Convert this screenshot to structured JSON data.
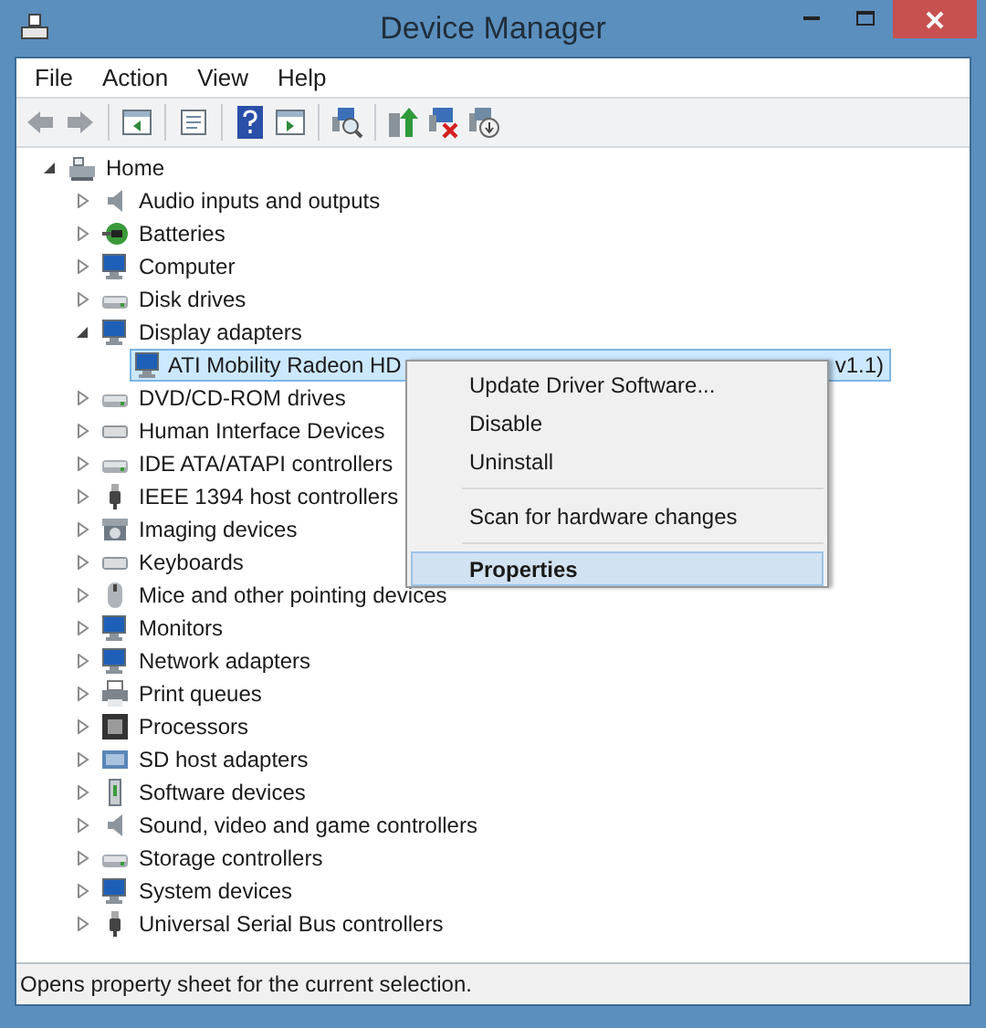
{
  "window": {
    "title": "Device Manager"
  },
  "menu": [
    "File",
    "Action",
    "View",
    "Help"
  ],
  "tree": {
    "label": "Home",
    "expanded": true,
    "children": [
      {
        "label": "Audio inputs and outputs",
        "expanded": false
      },
      {
        "label": "Batteries",
        "expanded": false
      },
      {
        "label": "Computer",
        "expanded": false
      },
      {
        "label": "Disk drives",
        "expanded": false
      },
      {
        "label": "Display adapters",
        "expanded": true,
        "children": [
          {
            "label": "ATI Mobility Radeon HD",
            "label_tail": "v1.1)",
            "selected": true
          }
        ]
      },
      {
        "label": "DVD/CD-ROM drives",
        "expanded": false
      },
      {
        "label": "Human Interface Devices",
        "expanded": false
      },
      {
        "label": "IDE ATA/ATAPI controllers",
        "expanded": false
      },
      {
        "label": "IEEE 1394 host controllers",
        "expanded": false
      },
      {
        "label": "Imaging devices",
        "expanded": false
      },
      {
        "label": "Keyboards",
        "expanded": false
      },
      {
        "label": "Mice and other pointing devices",
        "expanded": false
      },
      {
        "label": "Monitors",
        "expanded": false
      },
      {
        "label": "Network adapters",
        "expanded": false
      },
      {
        "label": "Print queues",
        "expanded": false
      },
      {
        "label": "Processors",
        "expanded": false
      },
      {
        "label": "SD host adapters",
        "expanded": false
      },
      {
        "label": "Software devices",
        "expanded": false
      },
      {
        "label": "Sound, video and game controllers",
        "expanded": false
      },
      {
        "label": "Storage controllers",
        "expanded": false
      },
      {
        "label": "System devices",
        "expanded": false
      },
      {
        "label": "Universal Serial Bus controllers",
        "expanded": false
      }
    ]
  },
  "context_menu": [
    {
      "kind": "item",
      "label": "Update Driver Software...",
      "selected": false
    },
    {
      "kind": "item",
      "label": "Disable",
      "selected": false
    },
    {
      "kind": "item",
      "label": "Uninstall",
      "selected": false
    },
    {
      "kind": "separator"
    },
    {
      "kind": "item",
      "label": "Scan for hardware changes",
      "selected": false
    },
    {
      "kind": "separator"
    },
    {
      "kind": "item",
      "label": "Properties",
      "selected": true
    }
  ],
  "status_bar": "Opens property sheet for the current selection."
}
